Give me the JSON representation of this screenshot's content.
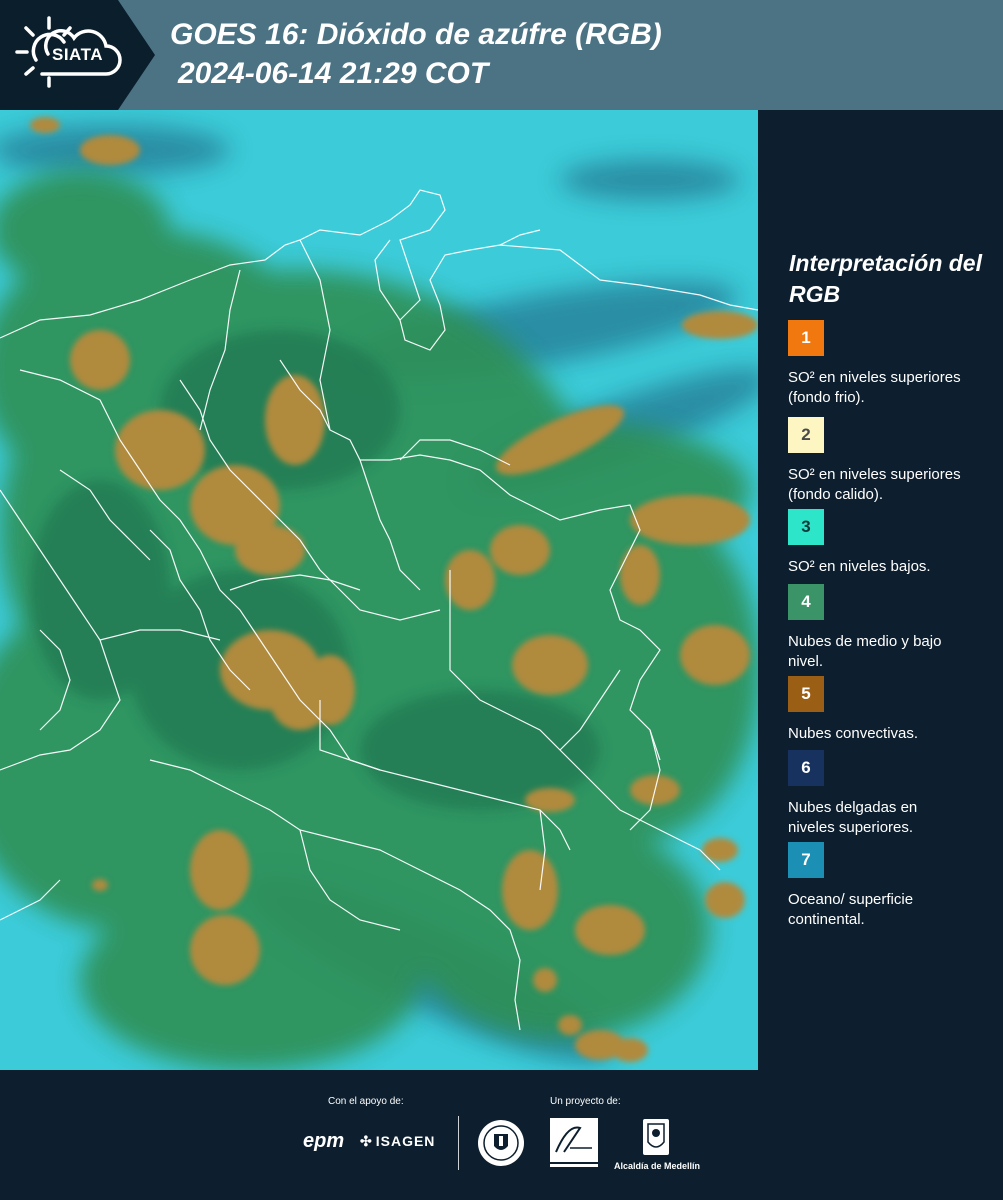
{
  "header": {
    "logo_text": "SIATA",
    "title": "GOES 16: Dióxido de azúfre (RGB)",
    "subtitle": "2024-06-14 21:29 COT"
  },
  "legend": {
    "title": "Interpretación del RGB",
    "items": [
      {
        "number": "1",
        "color": "#f0780e",
        "text_color": "#ffffff",
        "label": "SO² en niveles superiores (fondo frio)."
      },
      {
        "number": "2",
        "color": "#fdf6c3",
        "text_color": "#4a4a4a",
        "label": "SO² en niveles superiores (fondo calido)."
      },
      {
        "number": "3",
        "color": "#2de6c9",
        "text_color": "#0d3b3a",
        "label": "SO² en niveles bajos."
      },
      {
        "number": "4",
        "color": "#3a9468",
        "text_color": "#ffffff",
        "label": "Nubes de medio y bajo nivel."
      },
      {
        "number": "5",
        "color": "#9b5e15",
        "text_color": "#ffffff",
        "label": "Nubes convectivas."
      },
      {
        "number": "6",
        "color": "#17325f",
        "text_color": "#ffffff",
        "label": "Nubes delgadas en niveles superiores."
      },
      {
        "number": "7",
        "color": "#1c8fb5",
        "text_color": "#ffffff",
        "label": "Oceano/ superficie continental."
      }
    ]
  },
  "footer": {
    "support_label": "Con el apoyo de:",
    "project_label": "Un proyecto de:",
    "sponsor_1": "epm",
    "sponsor_2": "ISAGEN",
    "partner_1": "Área",
    "partner_2": "Alcaldía de Medellín"
  },
  "colors": {
    "header_bg": "#4c7384",
    "panel_bg": "#0d1f2e",
    "ocean": "#3ccbd8",
    "vegetation": "#2f8f55",
    "convective": "#b08a3c"
  }
}
